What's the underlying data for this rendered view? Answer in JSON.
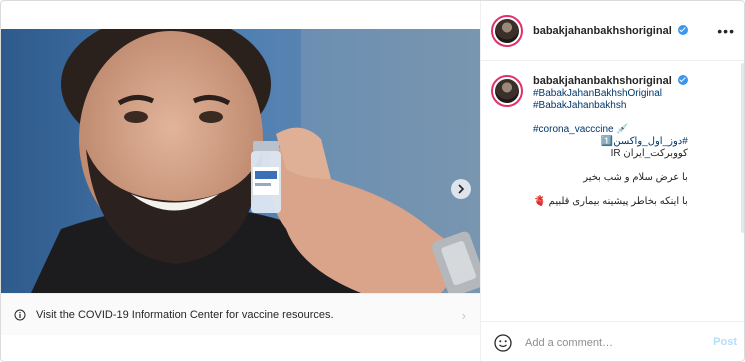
{
  "post": {
    "username": "babakjahanbakhshoriginal",
    "verified": true,
    "more_icon": "more-horizontal-icon"
  },
  "media": {
    "slide_count": 2,
    "active_slide": 1,
    "next_icon": "chevron-right-icon"
  },
  "info_bar": {
    "icon": "info-circle-icon",
    "text": "Visit the COVID-19 Information Center for vaccine resources.",
    "chevron": "›"
  },
  "caption": {
    "username": "babakjahanbakhshoriginal",
    "lines": {
      "l1": "#BabakJahanBakhshOriginal",
      "l2": "#BabakJahanbakhsh",
      "l3": "#corona_vacccine 💉",
      "l4": "#دوز_اول_واکسن1️⃣",
      "l5": "کووبرکت_ایران IR",
      "l6": "با عرض سلام و شب بخیر",
      "l7": "با اینکه بخاطر پیشینه بیماری قلبیم 🫀"
    }
  },
  "comment": {
    "placeholder": "Add a comment…",
    "post_label": "Post",
    "emoji_icon": "emoji-smile-icon"
  },
  "colors": {
    "link": "#00376b",
    "verified": "#3897f0",
    "post_disabled": "#b2dffc",
    "story_ring": "#e1306c"
  }
}
